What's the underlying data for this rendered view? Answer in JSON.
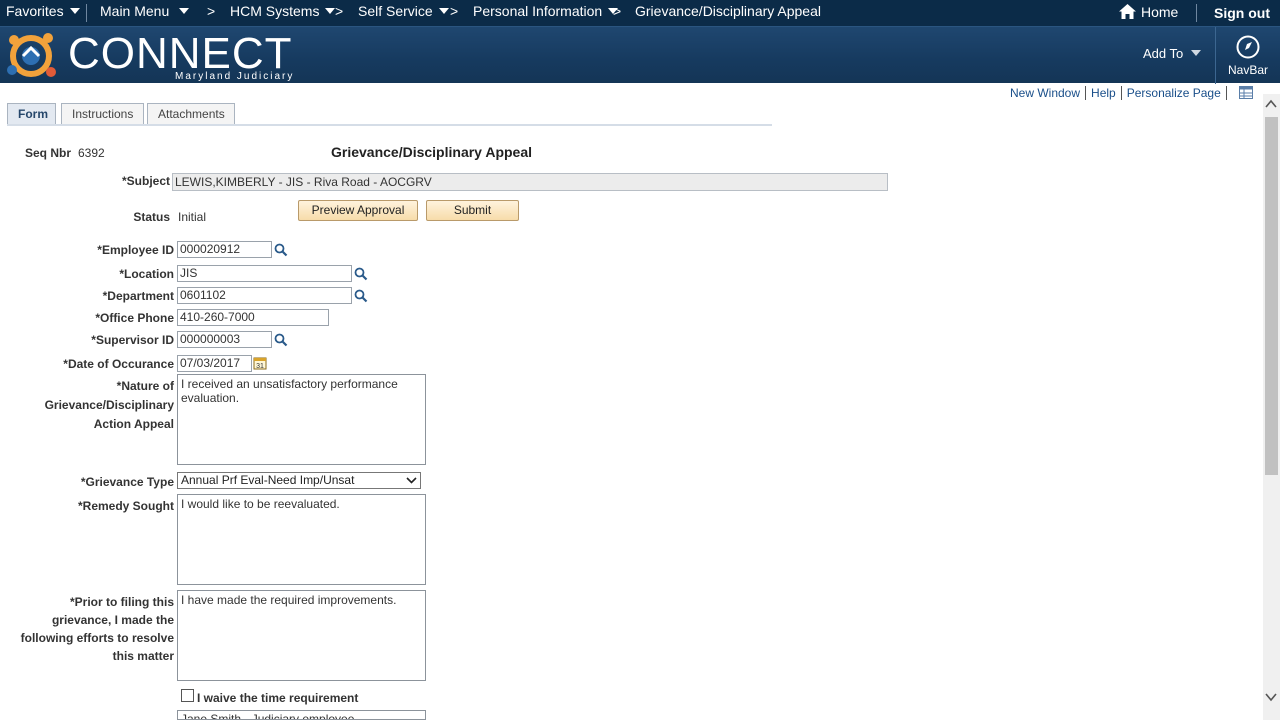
{
  "topnav": {
    "favorites": "Favorites",
    "main_menu": "Main Menu",
    "separator": ">",
    "breadcrumbs": [
      "HCM Systems",
      "Self Service",
      "Personal Information"
    ],
    "current": "Grievance/Disciplinary Appeal",
    "home": "Home",
    "sign_out": "Sign out"
  },
  "banner": {
    "logo_text": "CONNECT",
    "logo_sub": "Maryland Judiciary",
    "add_to": "Add To",
    "navbar": "NavBar"
  },
  "pagelinks": [
    "New Window",
    "Help",
    "Personalize Page"
  ],
  "tabs": [
    {
      "label": "Form",
      "active": true
    },
    {
      "label": "Instructions",
      "active": false
    },
    {
      "label": "Attachments",
      "active": false
    }
  ],
  "form": {
    "seq_label": "Seq Nbr",
    "seq_value": "6392",
    "title": "Grievance/Disciplinary Appeal",
    "subject_label": "*Subject",
    "subject_value": "LEWIS,KIMBERLY - JIS - Riva Road - AOCGRV",
    "status_label": "Status",
    "status_value": "Initial",
    "preview_button": "Preview Approval",
    "submit_button": "Submit",
    "employee_id_label": "*Employee ID",
    "employee_id": "000020912",
    "location_label": "*Location",
    "location": "JIS",
    "department_label": "*Department",
    "department": "0601102",
    "office_phone_label": "*Office Phone",
    "office_phone": "410-260-7000",
    "supervisor_id_label": "*Supervisor ID",
    "supervisor_id": "000000003",
    "date_label": "*Date of Occurance",
    "date_value": "07/03/2017",
    "nature_label_1": "*Nature of",
    "nature_label_2": "Grievance/Disciplinary",
    "nature_label_3": "Action Appeal",
    "nature_value": "I received an unsatisfactory performance evaluation.",
    "grievance_type_label": "*Grievance Type",
    "grievance_type": "Annual Prf Eval-Need Imp/Unsat",
    "remedy_label": "*Remedy Sought",
    "remedy_value": "I would like to be reevaluated.",
    "prior_label_1": "*Prior to filing this",
    "prior_label_2": "grievance, I made the",
    "prior_label_3": "following efforts to resolve",
    "prior_label_4": "this matter",
    "prior_value": "I have made the required improvements.",
    "waive_label": "I waive the time requirement",
    "next_value": "Jane Smith - Judiciary employee"
  }
}
